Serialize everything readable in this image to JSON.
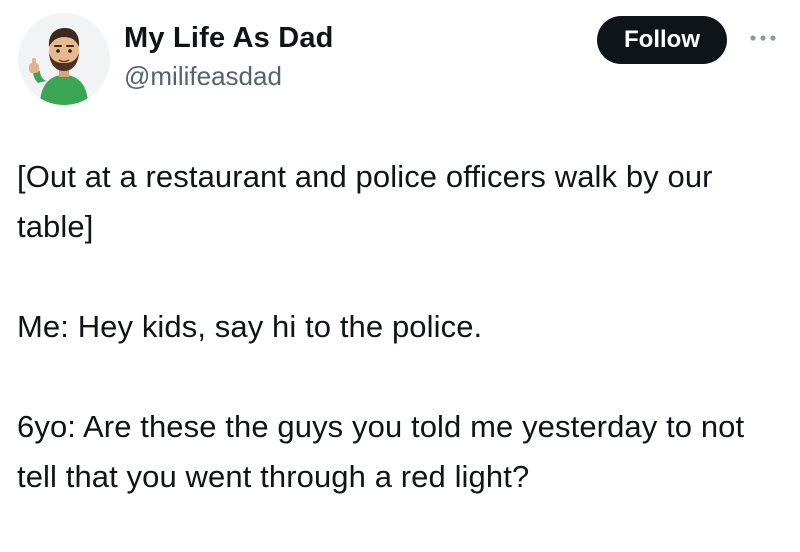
{
  "author": {
    "display_name": "My Life As Dad",
    "handle": "@milifeasdad",
    "avatar_icon": "bitmoji-dad-thumbs-up-avatar"
  },
  "actions": {
    "follow_label": "Follow",
    "more_icon": "more-options-icon"
  },
  "tweet": {
    "paragraphs": [
      "[Out at a restaurant and police officers walk by our table]",
      "Me: Hey kids, say hi to the police.",
      "6yo: Are these the guys you told me yesterday to not tell that you went through a red light?"
    ]
  },
  "colors": {
    "text": "#0f1419",
    "secondary_text": "#536471",
    "follow_bg": "#0f1419",
    "follow_text": "#ffffff",
    "avatar_shirt": "#3aa655"
  }
}
